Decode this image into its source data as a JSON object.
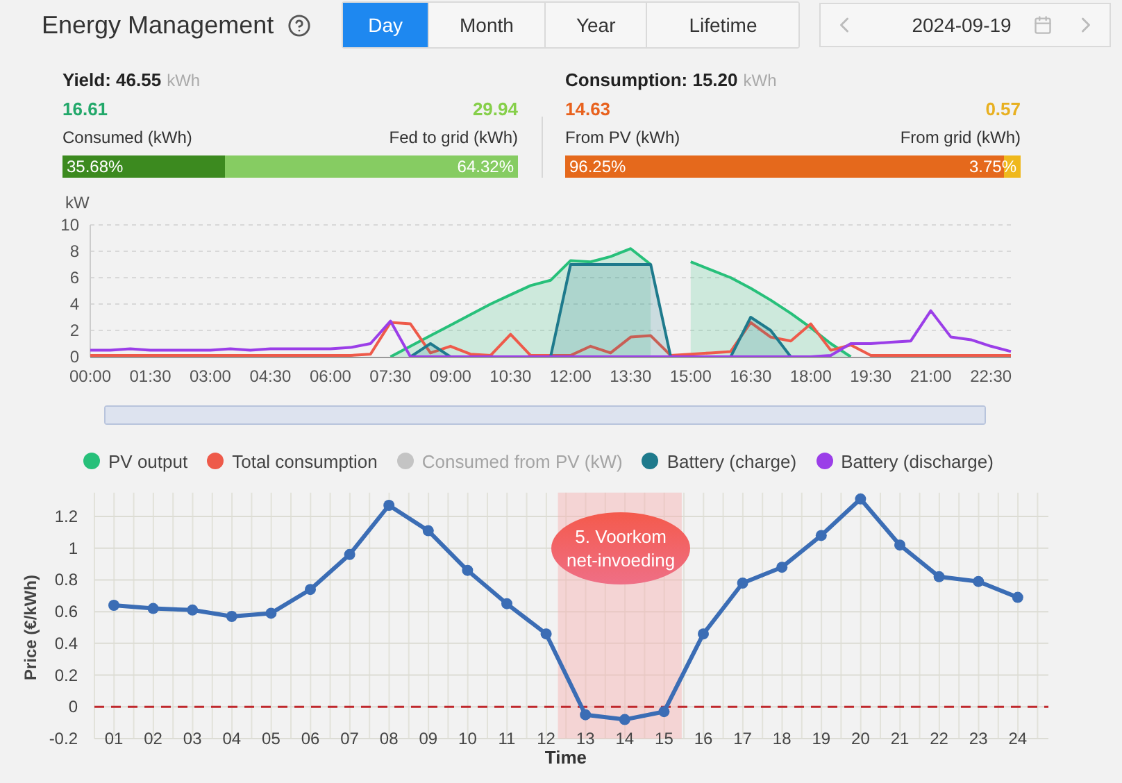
{
  "header": {
    "title": "Energy Management",
    "tabs": [
      {
        "label": "Day",
        "selected": true
      },
      {
        "label": "Month",
        "selected": false
      },
      {
        "label": "Year",
        "selected": false
      },
      {
        "label": "Lifetime",
        "selected": false
      }
    ],
    "date": "2024-09-19"
  },
  "summaries": [
    {
      "label": "Yield:",
      "value": "46.55",
      "unit": "kWh",
      "left": {
        "value": "16.61",
        "label": "Consumed (kWh)",
        "color": "#22a86a"
      },
      "right": {
        "value": "29.94",
        "label": "Fed to grid (kWh)",
        "color": "#86cf4a"
      },
      "bar": [
        {
          "text": "35.68%",
          "level": 0.3568,
          "color": "#3c8a1f"
        },
        {
          "text": "64.32%",
          "level": 0.6432,
          "color": "#86cc62"
        }
      ]
    },
    {
      "label": "Consumption:",
      "value": "15.20",
      "unit": "kWh",
      "left": {
        "value": "14.63",
        "label": "From PV (kWh)",
        "color": "#e8621e"
      },
      "right": {
        "value": "0.57",
        "label": "From grid (kWh)",
        "color": "#e8b020"
      },
      "bar": [
        {
          "text": "96.25%",
          "level": 0.9625,
          "color": "#e5691c"
        },
        {
          "text": "3.75%",
          "level": 0.0375,
          "color": "#efb81c"
        }
      ]
    }
  ],
  "power_chart": {
    "chart_data": {
      "type": "line",
      "ylabel": "kW",
      "grid": true,
      "x": [
        0,
        0.5,
        1,
        1.5,
        2,
        2.5,
        3,
        3.5,
        4,
        4.5,
        5,
        5.5,
        6,
        6.5,
        7,
        7.5,
        8,
        8.5,
        9,
        9.5,
        10,
        10.5,
        11,
        11.5,
        12,
        12.5,
        13,
        13.5,
        14,
        14.5,
        15,
        15.5,
        16,
        16.5,
        17,
        17.5,
        18,
        18.5,
        19,
        19.5,
        20,
        20.5,
        21,
        21.5,
        22,
        22.5,
        23
      ],
      "xlim": [
        0,
        23
      ],
      "ylim": [
        0,
        10
      ],
      "yticks": [
        0,
        2,
        4,
        6,
        8,
        10
      ],
      "xticks": [
        {
          "value": 0,
          "label": "00:00"
        },
        {
          "value": 1.5,
          "label": "01:30"
        },
        {
          "value": 3,
          "label": "03:00"
        },
        {
          "value": 4.5,
          "label": "04:30"
        },
        {
          "value": 6,
          "label": "06:00"
        },
        {
          "value": 7.5,
          "label": "07:30"
        },
        {
          "value": 9,
          "label": "09:00"
        },
        {
          "value": 10.5,
          "label": "10:30"
        },
        {
          "value": 12,
          "label": "12:00"
        },
        {
          "value": 13.5,
          "label": "13:30"
        },
        {
          "value": 15,
          "label": "15:00"
        },
        {
          "value": 16.5,
          "label": "16:30"
        },
        {
          "value": 18,
          "label": "18:00"
        },
        {
          "value": 19.5,
          "label": "19:30"
        },
        {
          "value": 21,
          "label": "21:00"
        },
        {
          "value": 22.5,
          "label": "22:30"
        }
      ],
      "series": [
        {
          "name": "PV output",
          "type": "area",
          "color": "#27c07a",
          "values": [
            null,
            null,
            null,
            null,
            null,
            null,
            null,
            null,
            null,
            null,
            null,
            null,
            null,
            null,
            null,
            0,
            0.8,
            1.6,
            2.4,
            3.2,
            4,
            4.7,
            5.4,
            5.8,
            7.3,
            7.2,
            7.6,
            8.2,
            7,
            null,
            7.2,
            6.6,
            6,
            5.2,
            4.3,
            3.3,
            2.2,
            1,
            0,
            null,
            null,
            null,
            null,
            null,
            null,
            null,
            null
          ]
        },
        {
          "name": "Total consumption",
          "color": "#ee5a4a",
          "values": [
            0.1,
            0.1,
            0.1,
            0.1,
            0.1,
            0.1,
            0.1,
            0.1,
            0.1,
            0.1,
            0.1,
            0.1,
            0.1,
            0.1,
            0.2,
            2.6,
            2.5,
            0.3,
            0.8,
            0.2,
            0.1,
            1.7,
            0.1,
            0.1,
            0.1,
            0.8,
            0.3,
            1.5,
            1.6,
            0.1,
            0.2,
            0.3,
            0.4,
            2.6,
            1.5,
            1.2,
            2.5,
            0.5,
            0.9,
            0.1,
            0.1,
            0.1,
            0.1,
            0.1,
            0.1,
            0.1,
            0.1
          ]
        },
        {
          "name": "Consumed from PV (kW)",
          "color": "#c4c4c4",
          "values": [
            null,
            null,
            null,
            null,
            null,
            null,
            null,
            null,
            null,
            null,
            null,
            null,
            null,
            null,
            null,
            null,
            null,
            null,
            null,
            null,
            null,
            null,
            null,
            null,
            null,
            null,
            null,
            null,
            null,
            null,
            null,
            null,
            null,
            null,
            null,
            null,
            null,
            null,
            null,
            null,
            null,
            null,
            null,
            null,
            null,
            null,
            null
          ]
        },
        {
          "name": "Battery (charge)",
          "type": "area",
          "color": "#1e7a8c",
          "values": [
            null,
            null,
            null,
            null,
            null,
            null,
            null,
            null,
            null,
            null,
            null,
            null,
            null,
            null,
            null,
            null,
            0,
            1,
            0,
            null,
            null,
            null,
            null,
            0,
            7,
            7,
            7,
            7,
            7,
            0,
            null,
            null,
            0,
            3,
            2,
            0,
            null,
            null,
            null,
            null,
            null,
            null,
            null,
            null,
            null,
            null,
            null
          ]
        },
        {
          "name": "Battery (discharge)",
          "color": "#9b3ee8",
          "values": [
            0.5,
            0.5,
            0.6,
            0.5,
            0.5,
            0.5,
            0.5,
            0.6,
            0.5,
            0.6,
            0.6,
            0.6,
            0.6,
            0.7,
            1,
            2.7,
            0,
            0,
            0,
            0,
            0,
            0,
            0,
            0,
            0,
            0,
            0,
            0,
            0,
            0,
            0,
            0,
            0,
            0,
            0,
            0,
            0,
            0.1,
            1,
            1,
            1.1,
            1.2,
            3.5,
            1.5,
            1.3,
            0.8,
            0.4
          ]
        }
      ]
    },
    "range_slider": {
      "level": 1
    },
    "legend": [
      {
        "enabled": true
      },
      {
        "enabled": true
      },
      {
        "enabled": false
      },
      {
        "enabled": true
      },
      {
        "enabled": true
      }
    ]
  },
  "price_chart": {
    "chart_data": {
      "type": "line",
      "xlabel": "Time",
      "ylabel": "Price  (€/kWh)",
      "grid": true,
      "categories": [
        "01",
        "02",
        "03",
        "04",
        "05",
        "06",
        "07",
        "08",
        "09",
        "10",
        "11",
        "12",
        "13",
        "14",
        "15",
        "16",
        "17",
        "18",
        "19",
        "20",
        "21",
        "22",
        "23",
        "24"
      ],
      "ylim": [
        -0.2,
        1.35
      ],
      "yticks": [
        {
          "value": -0.2,
          "label": "-0.2"
        },
        {
          "value": 0,
          "label": "0"
        },
        {
          "value": 0.2,
          "label": "0.2"
        },
        {
          "value": 0.4,
          "label": "0.4"
        },
        {
          "value": 0.6,
          "label": "0.6"
        },
        {
          "value": 0.8,
          "label": "0.8"
        },
        {
          "value": 1,
          "label": "1"
        },
        {
          "value": 1.2,
          "label": "1.2"
        }
      ],
      "series": [
        {
          "color": "#3b6db5",
          "marker": "circle",
          "values": [
            0.64,
            0.62,
            0.61,
            0.57,
            0.59,
            0.74,
            0.96,
            1.27,
            1.11,
            0.86,
            0.65,
            0.46,
            -0.05,
            -0.08,
            -0.03,
            0.46,
            0.78,
            0.88,
            1.08,
            1.31,
            1.02,
            0.82,
            0.79,
            0.69
          ]
        }
      ],
      "ref_lines": [
        {
          "axis": "y",
          "value": 0,
          "color": "#c0282d"
        }
      ],
      "annotations": [
        {
          "text": "5. Voorkom net-invoeding"
        }
      ]
    }
  }
}
